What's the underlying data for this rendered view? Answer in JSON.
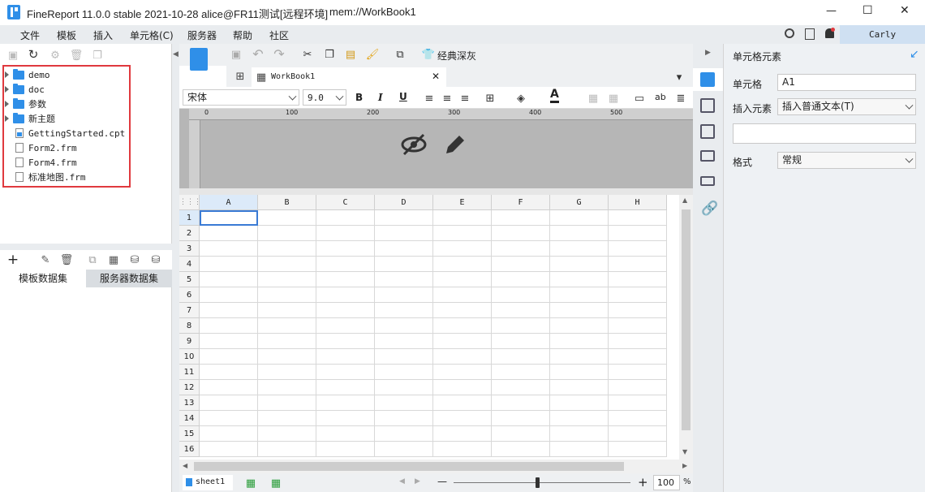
{
  "window": {
    "title": "FineReport 11.0.0 stable 2021-10-28 alice@FR11测试[远程环境]",
    "path": "mem://WorkBook1",
    "buttons": {
      "minimize": "—",
      "maximize": "☐",
      "close": "✕"
    }
  },
  "menu": {
    "items": [
      {
        "label": "文件"
      },
      {
        "label": "模板"
      },
      {
        "label": "插入"
      },
      {
        "label": "单元格(C)"
      },
      {
        "label": "服务器"
      },
      {
        "label": "帮助"
      },
      {
        "label": "社区"
      }
    ],
    "user": "Carly"
  },
  "file_tree": {
    "items": [
      {
        "label": "demo",
        "kind": "folder"
      },
      {
        "label": "doc",
        "kind": "folder"
      },
      {
        "label": "参数",
        "kind": "folder"
      },
      {
        "label": "新主题",
        "kind": "folder"
      },
      {
        "label": "GettingStarted.cpt",
        "kind": "cpt"
      },
      {
        "label": "Form2.frm",
        "kind": "frm"
      },
      {
        "label": "Form4.frm",
        "kind": "frm"
      },
      {
        "label": "标准地图.frm",
        "kind": "frm"
      }
    ],
    "highlight_color": "#e0393e"
  },
  "dataset_tabs": {
    "template": "模板数据集",
    "server": "服务器数据集"
  },
  "toolbar": {
    "theme_label": "经典深灰"
  },
  "editor_tab": {
    "label": "WorkBook1"
  },
  "format_bar": {
    "font": "宋体",
    "size": "9.0",
    "bold": "B",
    "italic": "I",
    "underline": "U",
    "wrap": "ab"
  },
  "ruler": {
    "ticks": [
      "0",
      "100",
      "200",
      "300",
      "400",
      "500"
    ]
  },
  "grid": {
    "columns": [
      "A",
      "B",
      "C",
      "D",
      "E",
      "F",
      "G",
      "H"
    ],
    "rows": [
      "1",
      "2",
      "3",
      "4",
      "5",
      "6",
      "7",
      "8",
      "9",
      "10",
      "11",
      "12",
      "13",
      "14",
      "15",
      "16"
    ],
    "selected": "A1"
  },
  "sheet_bar": {
    "sheet": "sheet1",
    "zoom": "100",
    "percent": "%",
    "minus": "—",
    "plus": "+"
  },
  "right_panel": {
    "title": "单元格元素",
    "cell_label": "单元格",
    "cell_value": "A1",
    "insert_label": "插入元素",
    "insert_value": "插入普通文本(T)",
    "format_label": "格式",
    "format_value": "常规"
  },
  "colors": {
    "accent": "#2f8fe8",
    "selection": "#3a7bd5",
    "header_bg": "#f3f3f3"
  }
}
